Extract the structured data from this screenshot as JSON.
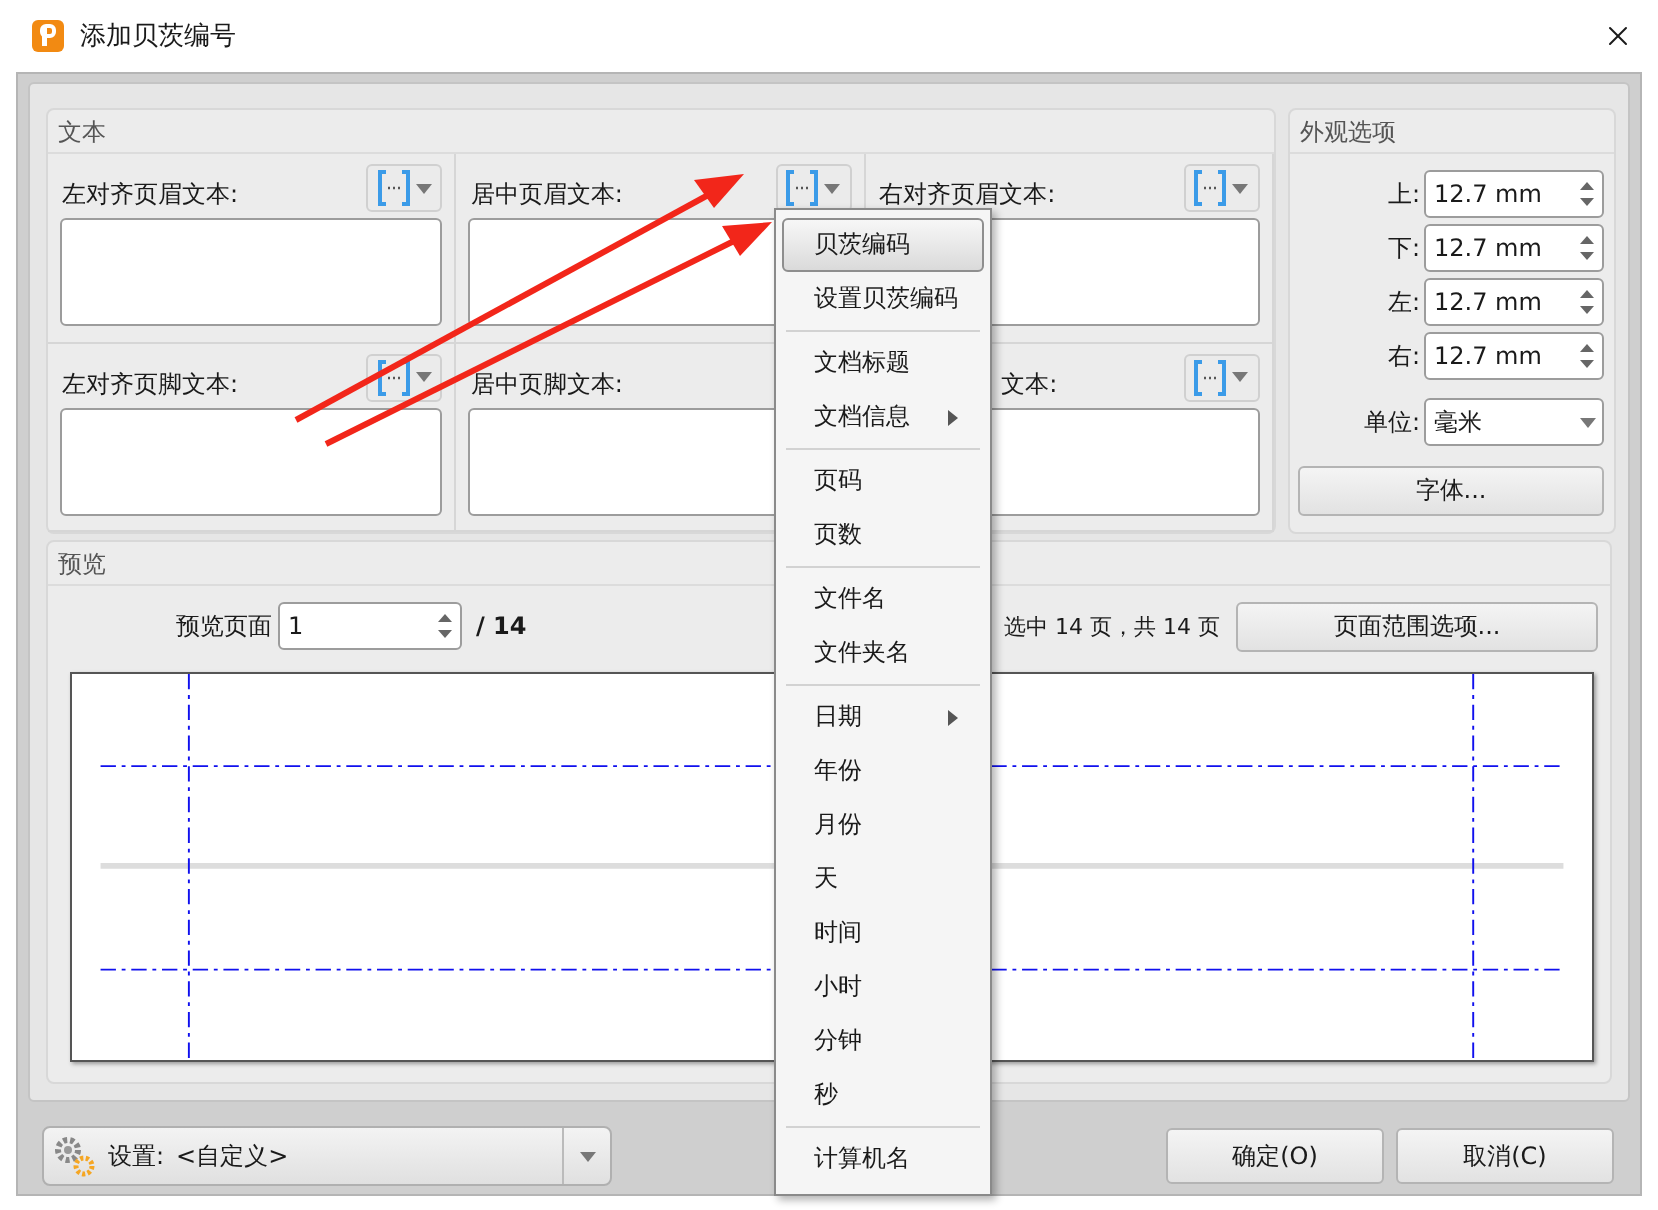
{
  "window": {
    "title": "添加贝茨编号"
  },
  "text_group": {
    "title": "文本",
    "fields": [
      {
        "label": "左对齐页眉文本:"
      },
      {
        "label": "居中页眉文本:"
      },
      {
        "label": "右对齐页眉文本:"
      },
      {
        "label": "左对齐页脚文本:"
      },
      {
        "label": "居中页脚文本:"
      },
      {
        "label": "文本:",
        "partial": true
      }
    ]
  },
  "appearance": {
    "title": "外观选项",
    "margins": [
      {
        "label": "上:",
        "value": "12.7 mm"
      },
      {
        "label": "下:",
        "value": "12.7 mm"
      },
      {
        "label": "左:",
        "value": "12.7 mm"
      },
      {
        "label": "右:",
        "value": "12.7 mm"
      }
    ],
    "unit": {
      "label": "单位:",
      "value": "毫米"
    },
    "font_button": "字体..."
  },
  "preview": {
    "title": "预览",
    "page_label": "预览页面",
    "page_value": "1",
    "page_total": "/ 14",
    "selection_info": "选中 14 页，共 14 页",
    "range_button": "页面范围选项..."
  },
  "settings": {
    "label": "设置:",
    "value": "<自定义>"
  },
  "buttons": [
    "确定(O)",
    "取消(C)"
  ],
  "menu": {
    "items": [
      {
        "kind": "item",
        "label": "贝茨编码",
        "selected": true,
        "submenu": false
      },
      {
        "kind": "item",
        "label": "设置贝茨编码",
        "selected": false,
        "submenu": false
      },
      {
        "kind": "separator"
      },
      {
        "kind": "item",
        "label": "文档标题",
        "selected": false,
        "submenu": false
      },
      {
        "kind": "item",
        "label": "文档信息",
        "selected": false,
        "submenu": true
      },
      {
        "kind": "separator"
      },
      {
        "kind": "item",
        "label": "页码",
        "selected": false,
        "submenu": false
      },
      {
        "kind": "item",
        "label": "页数",
        "selected": false,
        "submenu": false
      },
      {
        "kind": "separator"
      },
      {
        "kind": "item",
        "label": "文件名",
        "selected": false,
        "submenu": false
      },
      {
        "kind": "item",
        "label": "文件夹名",
        "selected": false,
        "submenu": false
      },
      {
        "kind": "separator"
      },
      {
        "kind": "item",
        "label": "日期",
        "selected": false,
        "submenu": true
      },
      {
        "kind": "item",
        "label": "年份",
        "selected": false,
        "submenu": false
      },
      {
        "kind": "item",
        "label": "月份",
        "selected": false,
        "submenu": false
      },
      {
        "kind": "item",
        "label": "天",
        "selected": false,
        "submenu": false
      },
      {
        "kind": "item",
        "label": "时间",
        "selected": false,
        "submenu": false
      },
      {
        "kind": "item",
        "label": "小时",
        "selected": false,
        "submenu": false
      },
      {
        "kind": "item",
        "label": "分钟",
        "selected": false,
        "submenu": false
      },
      {
        "kind": "item",
        "label": "秒",
        "selected": false,
        "submenu": false
      },
      {
        "kind": "separator"
      },
      {
        "kind": "item",
        "label": "计算机名",
        "selected": false,
        "submenu": false
      }
    ]
  }
}
